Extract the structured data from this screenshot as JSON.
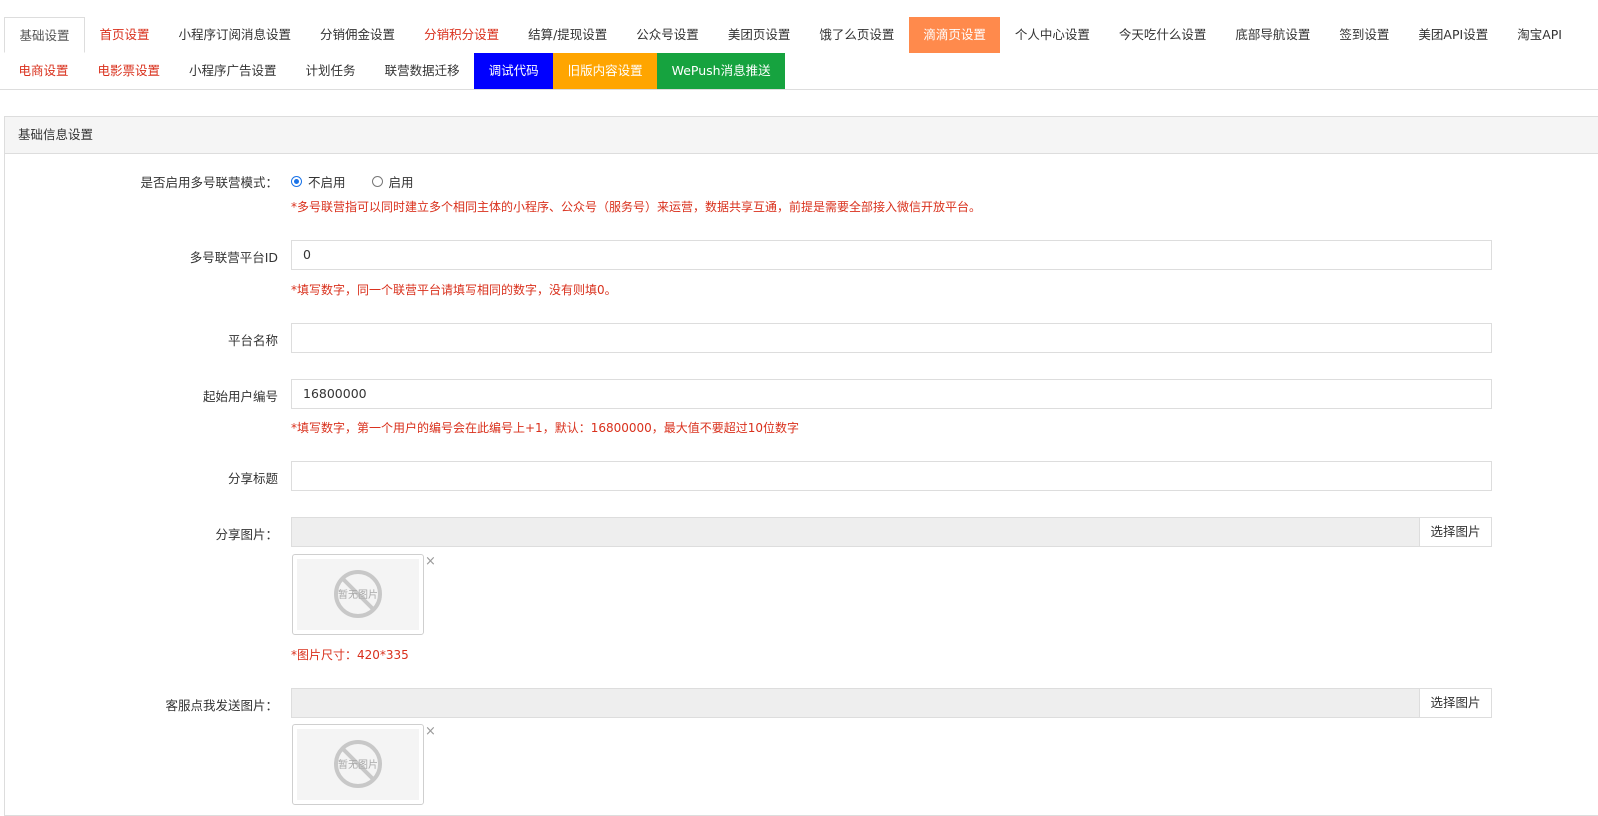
{
  "tabs_row1": [
    {
      "label": "基础设置",
      "style": "active"
    },
    {
      "label": "首页设置",
      "style": "red"
    },
    {
      "label": "小程序订阅消息设置",
      "style": ""
    },
    {
      "label": "分销佣金设置",
      "style": ""
    },
    {
      "label": "分销积分设置",
      "style": "red"
    },
    {
      "label": "结算/提现设置",
      "style": ""
    },
    {
      "label": "公众号设置",
      "style": ""
    },
    {
      "label": "美团页设置",
      "style": ""
    },
    {
      "label": "饿了么页设置",
      "style": ""
    },
    {
      "label": "滴滴页设置",
      "style": "didi"
    },
    {
      "label": "个人中心设置",
      "style": ""
    },
    {
      "label": "今天吃什么设置",
      "style": ""
    },
    {
      "label": "底部导航设置",
      "style": ""
    },
    {
      "label": "签到设置",
      "style": ""
    },
    {
      "label": "美团API设置",
      "style": ""
    },
    {
      "label": "淘宝API",
      "style": ""
    }
  ],
  "tabs_row2": [
    {
      "label": "电商设置",
      "style": "red"
    },
    {
      "label": "电影票设置",
      "style": "red"
    },
    {
      "label": "小程序广告设置",
      "style": ""
    },
    {
      "label": "计划任务",
      "style": ""
    },
    {
      "label": "联营数据迁移",
      "style": ""
    },
    {
      "label": "调试代码",
      "style": "blue"
    },
    {
      "label": "旧版内容设置",
      "style": "orange-tab"
    },
    {
      "label": "WePush消息推送",
      "style": "green"
    }
  ],
  "panel": {
    "heading": "基础信息设置"
  },
  "form": {
    "multi_mode": {
      "label": "是否启用多号联营模式：",
      "options": [
        "不启用",
        "启用"
      ],
      "selected": "不启用",
      "help": "*多号联营指可以同时建立多个相同主体的小程序、公众号（服务号）来运营，数据共享互通，前提是需要全部接入微信开放平台。"
    },
    "platform_id": {
      "label": "多号联营平台ID",
      "value": "0",
      "help": "*填写数字，同一个联营平台请填写相同的数字，没有则填0。"
    },
    "platform_name": {
      "label": "平台名称",
      "value": ""
    },
    "start_user_no": {
      "label": "起始用户编号",
      "value": "16800000",
      "help": "*填写数字，第一个用户的编号会在此编号上+1，默认：16800000，最大值不要超过10位数字"
    },
    "share_title": {
      "label": "分享标题",
      "value": ""
    },
    "share_image": {
      "label": "分享图片：",
      "button": "选择图片",
      "placeholder_text": "暂无图片",
      "close": "×",
      "help": "*图片尺寸：420*335"
    },
    "service_image": {
      "label": "客服点我发送图片：",
      "button": "选择图片",
      "placeholder_text": "暂无图片",
      "close": "×"
    }
  },
  "colors": {
    "red": "#d9301c",
    "didi": "#ff8a4c",
    "blue": "#0000ff",
    "orange": "#ffa500",
    "green": "#16a33f"
  }
}
